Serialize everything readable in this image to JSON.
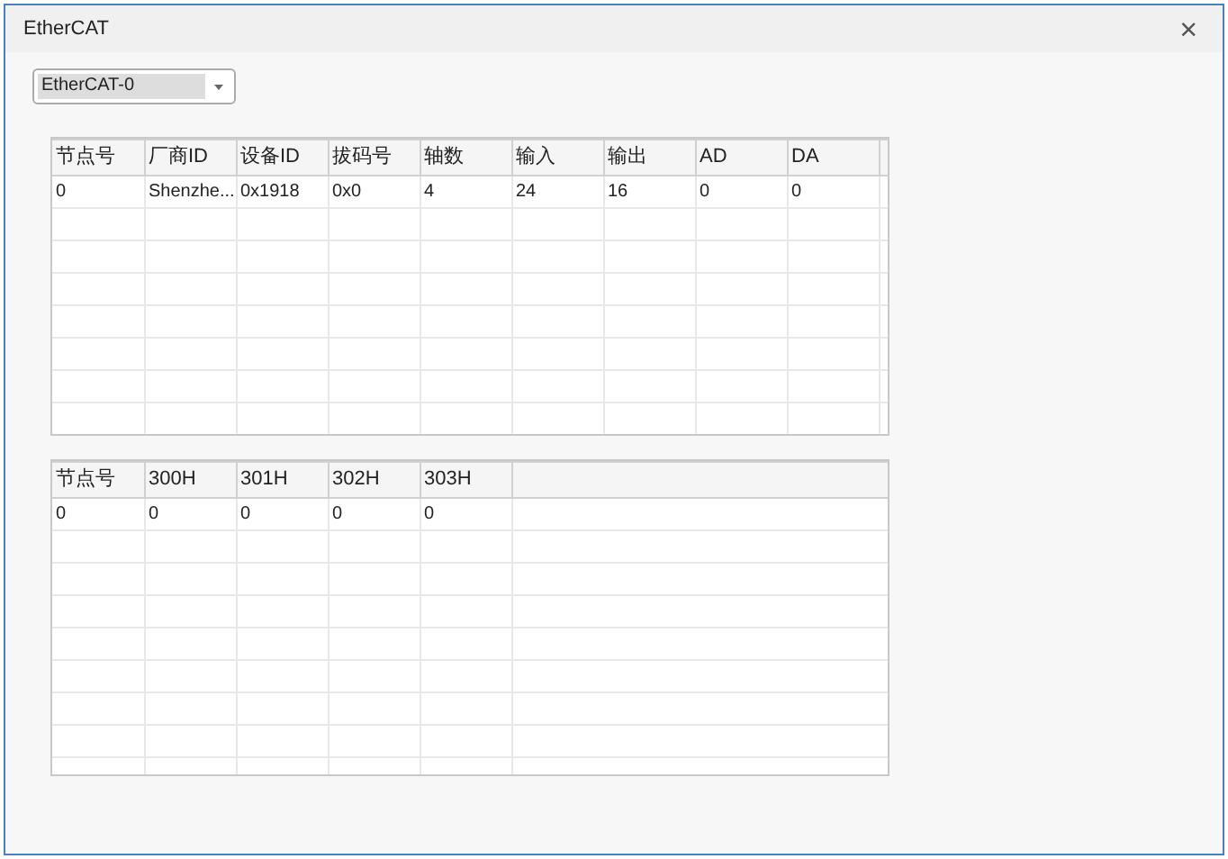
{
  "window": {
    "title": "EtherCAT",
    "close": "×"
  },
  "device_select": {
    "value": "EtherCAT-0"
  },
  "slave_table": {
    "columns": [
      "节点号",
      "厂商ID",
      "设备ID",
      "拔码号",
      "轴数",
      "输入",
      "输出",
      "AD",
      "DA"
    ],
    "rows": [
      [
        "0",
        "Shenzhe...",
        "0x1918",
        "0x0",
        "4",
        "24",
        "16",
        "0",
        "0"
      ]
    ]
  },
  "io_table": {
    "columns": [
      "节点号",
      "300H",
      "301H",
      "302H",
      "303H"
    ],
    "rows": [
      [
        "0",
        "0",
        "0",
        "0",
        "0"
      ]
    ]
  }
}
